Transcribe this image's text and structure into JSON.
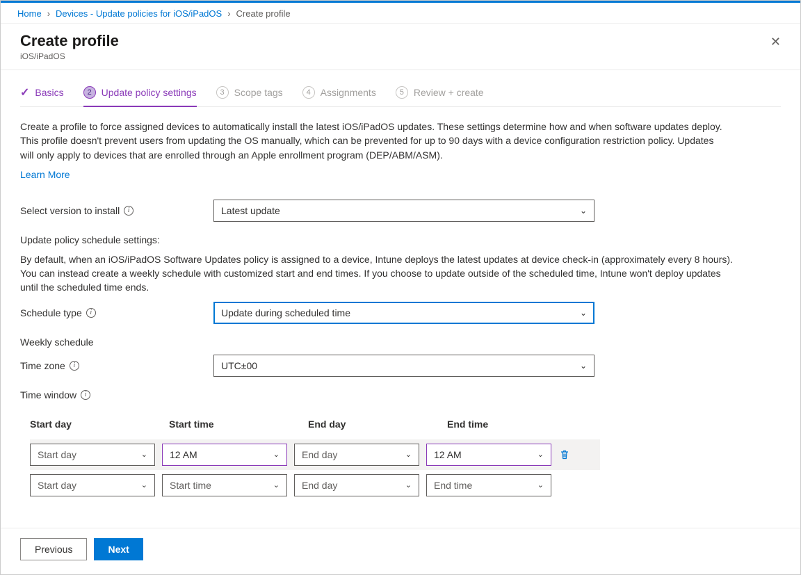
{
  "breadcrumb": {
    "items": [
      "Home",
      "Devices - Update policies for iOS/iPadOS",
      "Create profile"
    ]
  },
  "header": {
    "title": "Create profile",
    "subtitle": "iOS/iPadOS"
  },
  "tabs": {
    "t1": {
      "label": "Basics"
    },
    "t2": {
      "num": "2",
      "label": "Update policy settings"
    },
    "t3": {
      "num": "3",
      "label": "Scope tags"
    },
    "t4": {
      "num": "4",
      "label": "Assignments"
    },
    "t5": {
      "num": "5",
      "label": "Review + create"
    }
  },
  "intro": "Create a profile to force assigned devices to automatically install the latest iOS/iPadOS updates. These settings determine how and when software updates deploy. This profile doesn't prevent users from updating the OS manually, which can be prevented for up to 90 days with a device configuration restriction policy. Updates will only apply to devices that are enrolled through an Apple enrollment program (DEP/ABM/ASM).",
  "learn_more": "Learn More",
  "fields": {
    "version_label": "Select version to install",
    "version_value": "Latest update",
    "schedule_settings_label": "Update policy schedule settings:",
    "schedule_desc": "By default, when an iOS/iPadOS Software Updates policy is assigned to a device, Intune deploys the latest updates at device check-in (approximately every 8 hours). You can instead create a weekly schedule with customized start and end times. If you choose to update outside of the scheduled time, Intune won't deploy updates until the scheduled time ends.",
    "schedule_type_label": "Schedule type",
    "schedule_type_value": "Update during scheduled time",
    "weekly_label": "Weekly schedule",
    "timezone_label": "Time zone",
    "timezone_value": "UTC±00",
    "timewindow_label": "Time window"
  },
  "table": {
    "headers": {
      "start_day": "Start day",
      "start_time": "Start time",
      "end_day": "End day",
      "end_time": "End time"
    },
    "rows": [
      {
        "start_day": "Start day",
        "start_time": "12 AM",
        "end_day": "End day",
        "end_time": "12 AM",
        "has_trash": true,
        "selected": true
      },
      {
        "start_day": "Start day",
        "start_time": "Start time",
        "end_day": "End day",
        "end_time": "End time",
        "has_trash": false,
        "selected": false
      }
    ]
  },
  "footer": {
    "prev": "Previous",
    "next": "Next"
  }
}
